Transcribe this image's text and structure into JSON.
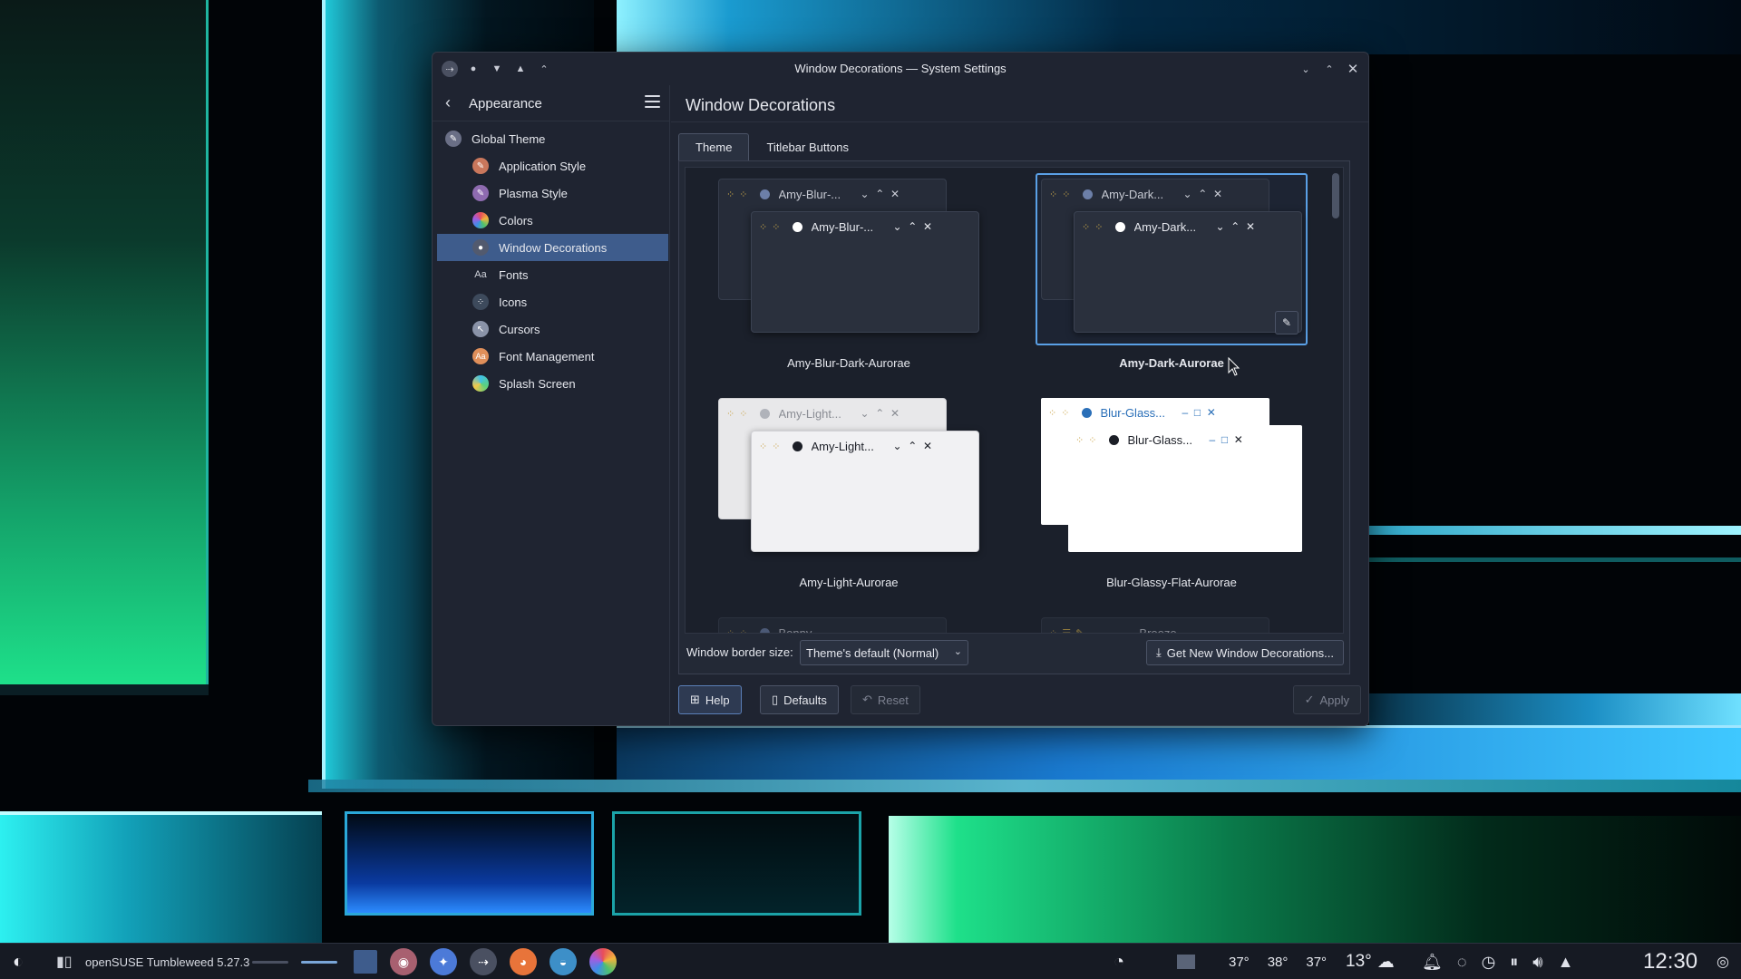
{
  "window": {
    "title": "Window Decorations — System Settings"
  },
  "sidebar": {
    "title": "Appearance",
    "items": [
      {
        "label": "Global Theme"
      },
      {
        "label": "Application Style"
      },
      {
        "label": "Plasma Style"
      },
      {
        "label": "Colors"
      },
      {
        "label": "Window Decorations"
      },
      {
        "label": "Fonts"
      },
      {
        "label": "Icons"
      },
      {
        "label": "Cursors"
      },
      {
        "label": "Font Management"
      },
      {
        "label": "Splash Screen"
      }
    ]
  },
  "main": {
    "title": "Window Decorations",
    "tabs": [
      {
        "label": "Theme"
      },
      {
        "label": "Titlebar Buttons"
      }
    ],
    "cards": [
      {
        "name": "Amy-Blur-Dark-Aurorae",
        "preview_back": "Amy-Blur-...",
        "preview_front": "Amy-Blur-..."
      },
      {
        "name": "Amy-Dark-Aurorae",
        "preview_back": "Amy-Dark...",
        "preview_front": "Amy-Dark..."
      },
      {
        "name": "Amy-Light-Aurorae",
        "preview_back": "Amy-Light...",
        "preview_front": "Amy-Light..."
      },
      {
        "name": "Blur-Glassy-Flat-Aurorae",
        "preview_back": "Blur-Glass...",
        "preview_front": "Blur-Glass..."
      },
      {
        "name": "",
        "preview_back": "Bonny..."
      },
      {
        "name": "",
        "preview_back": "Breeze"
      }
    ],
    "border_size_label": "Window border size:",
    "border_size_value": "Theme's default (Normal)",
    "get_new_label": "Get New Window Decorations..."
  },
  "footer": {
    "help": "Help",
    "defaults": "Defaults",
    "reset": "Reset",
    "apply": "Apply"
  },
  "taskbar": {
    "distro": "openSUSE Tumbleweed 5.27.3",
    "temps": [
      "37°",
      "38°",
      "37°"
    ],
    "weather_temp": "13°",
    "clock": "12:30"
  },
  "colors": {
    "accent": "#3e5c8c",
    "selection_border": "#5aa0e6",
    "window_bg": "#1f2431"
  }
}
